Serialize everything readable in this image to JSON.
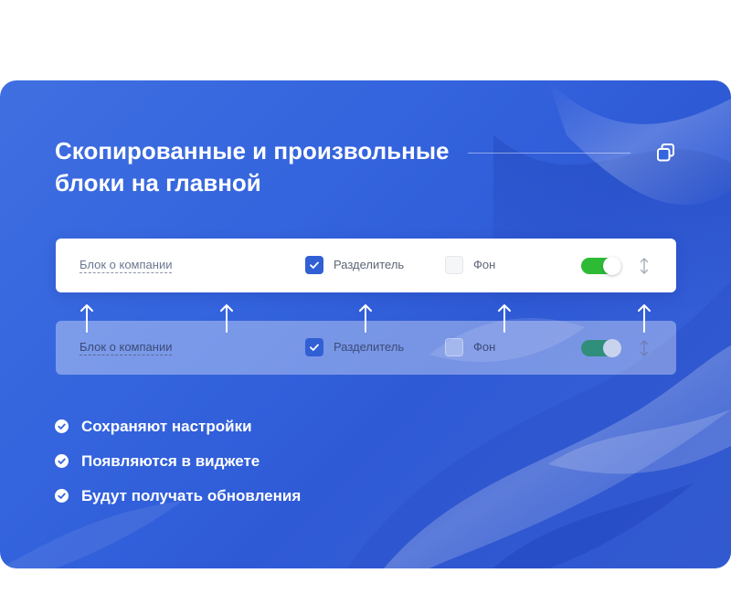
{
  "headline": {
    "line1": "Скопированные и произвольные",
    "line2": "блоки на главной"
  },
  "icons": {
    "copy": "copy-icon",
    "checkbox_check": "check-icon",
    "drag_handle": "drag-handle-icon",
    "feature_bullet": "check-circle-icon",
    "arrow": "arrow-up-icon"
  },
  "colors": {
    "accent_blue": "#3160d4",
    "toggle_green": "#2dbb36",
    "ghost_toggle": "#2f8f7b",
    "background_blue": "#3464de"
  },
  "block_row": {
    "title": "Блок о компании",
    "divider_label": "Разделитель",
    "divider_checked": true,
    "background_label": "Фон",
    "background_checked": false,
    "enabled": true
  },
  "ghost_row": {
    "title": "Блок о компании",
    "divider_label": "Разделитель",
    "divider_checked": true,
    "background_label": "Фон",
    "background_checked": false,
    "enabled": true
  },
  "features": [
    "Сохраняют настройки",
    "Появляются в виджете",
    "Будут получать обновления"
  ]
}
